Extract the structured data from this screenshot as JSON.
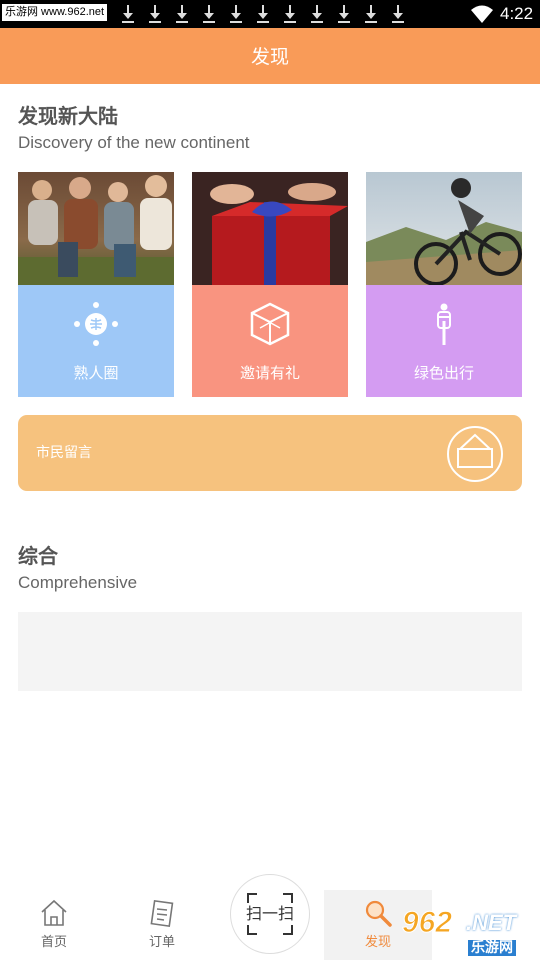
{
  "status_bar": {
    "watermark_text": "乐游网 www.962.net",
    "download_icon_count": 11,
    "time": "4:22"
  },
  "header": {
    "title": "发现"
  },
  "discover": {
    "title": "发现新大陆",
    "subtitle": "Discovery of the new continent",
    "cards": [
      {
        "label": "熟人圈",
        "icon": "people-network-icon",
        "color": "#9ec8f7"
      },
      {
        "label": "邀请有礼",
        "icon": "gift-box-icon",
        "color": "#f99480"
      },
      {
        "label": "绿色出行",
        "icon": "cyclist-icon",
        "color": "#d49cf2"
      }
    ],
    "banner": {
      "label": "市民留言",
      "icon": "bag-icon",
      "color": "#f6c27e"
    }
  },
  "comprehensive": {
    "title": "综合",
    "subtitle": "Comprehensive"
  },
  "bottom_nav": {
    "items": [
      {
        "label": "首页",
        "icon": "home-icon"
      },
      {
        "label": "订单",
        "icon": "order-icon"
      },
      {
        "label": "扫一扫",
        "icon": "scan-icon"
      },
      {
        "label": "发现",
        "icon": "search-icon",
        "active": true
      }
    ]
  },
  "watermark_logo": {
    "number": "962",
    "suffix": ".NET",
    "text": "乐游网"
  },
  "colors": {
    "accent": "#f99b58",
    "active_tab": "#f08a3c"
  }
}
